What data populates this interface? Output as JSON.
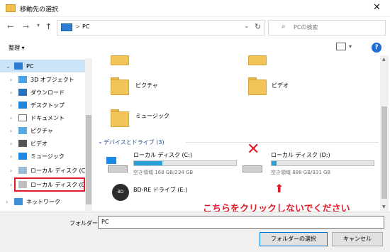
{
  "window": {
    "title": "移動先の選択",
    "close_glyph": "✕"
  },
  "address": {
    "back": "←",
    "forward": "→",
    "up": "↑",
    "separator": ">",
    "path": "PC",
    "refresh": "↻"
  },
  "search": {
    "placeholder": "PCの検索"
  },
  "toolbar": {
    "organize": "整理 ▾",
    "help": "?"
  },
  "tree": {
    "root": "PC",
    "items": [
      {
        "label": "3D オブジェクト",
        "icon": "3d-objects-icon"
      },
      {
        "label": "ダウンロード",
        "icon": "download-icon"
      },
      {
        "label": "デスクトップ",
        "icon": "desktop-icon"
      },
      {
        "label": "ドキュメント",
        "icon": "document-icon"
      },
      {
        "label": "ピクチャ",
        "icon": "pictures-icon"
      },
      {
        "label": "ビデオ",
        "icon": "video-icon"
      },
      {
        "label": "ミュージック",
        "icon": "music-icon"
      },
      {
        "label": "ローカル ディスク (C:)",
        "icon": "drive-c-icon"
      },
      {
        "label": "ローカル ディスク (D:)",
        "icon": "drive-d-icon"
      },
      {
        "label": "ネットワーク",
        "icon": "network-icon"
      }
    ]
  },
  "folders": [
    {
      "label": "ピクチャ"
    },
    {
      "label": "ビデオ"
    },
    {
      "label": "ミュージック"
    }
  ],
  "drives_section": "デバイスとドライブ (3)",
  "drives": [
    {
      "label": "ローカル ディスク (C:)",
      "space": "空き領域 168 GB/234 GB",
      "used_fraction": 0.28
    },
    {
      "label": "ローカル ディスク (D:)",
      "space": "空き領域 888 GB/931 GB",
      "used_fraction": 0.05
    },
    {
      "label": "BD-RE ドライブ (E:)"
    }
  ],
  "annotation": {
    "mark": "✕",
    "arrow": "⬆",
    "warning": "こちらをクリックしないでください"
  },
  "bottom": {
    "folder_label": "フォルダー:",
    "folder_value": "PC",
    "select_button": "フォルダーの選択",
    "cancel_button": "キャンセル"
  },
  "colors": {
    "accent": "#26a0da",
    "warning": "#e21b2b",
    "selection": "#cce4f7"
  }
}
